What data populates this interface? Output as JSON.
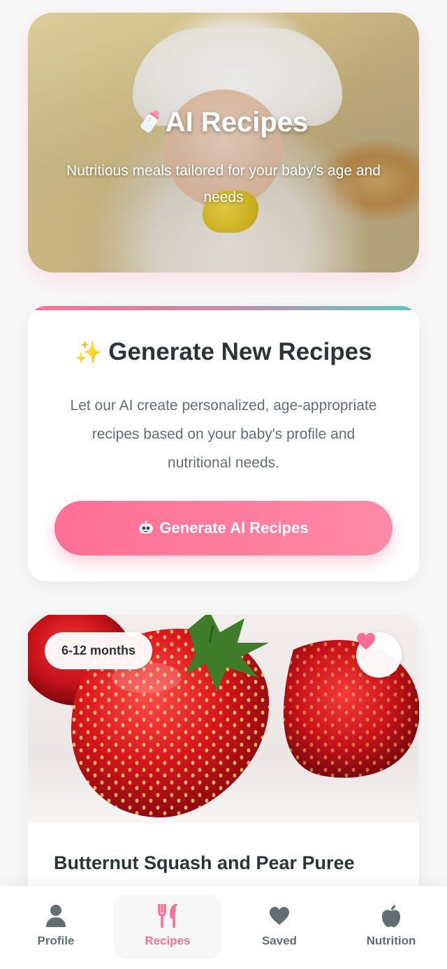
{
  "hero": {
    "title": "AI Recipes",
    "subtitle": "Nutritious meals tailored for your baby's age and needs",
    "icon": "baby-bottle-icon"
  },
  "generate": {
    "icon": "sparkles-icon",
    "title": "Generate New Recipes",
    "description": "Let our AI create personalized, age-appropriate recipes based on your baby's profile and nutritional needs.",
    "button_icon": "robot-icon",
    "button_label": "Generate AI Recipes"
  },
  "recipe": {
    "age_badge": "6-12 months",
    "favorite_icon": "heart-icon",
    "title": "Butternut Squash and Pear Puree"
  },
  "nav": {
    "items": [
      {
        "label": "Profile",
        "icon": "person-icon",
        "active": false
      },
      {
        "label": "Recipes",
        "icon": "utensils-icon",
        "active": true
      },
      {
        "label": "Saved",
        "icon": "heart-icon",
        "active": false
      },
      {
        "label": "Nutrition",
        "icon": "apple-icon",
        "active": false
      }
    ]
  },
  "colors": {
    "accent": "#ff6f95",
    "accent_light": "#ff8aa6",
    "teal": "#5fc8c0",
    "text_dark": "#2d3436",
    "text_muted": "#636e72"
  }
}
